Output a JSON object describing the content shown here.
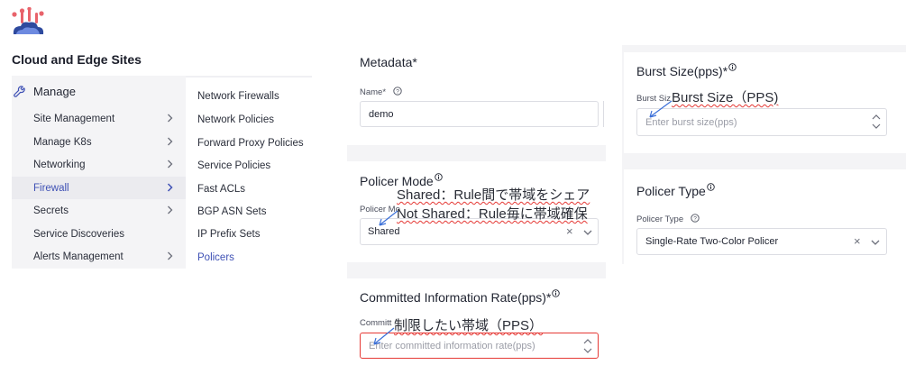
{
  "app": {
    "title": "Cloud and Edge Sites",
    "logo_icon": "cloud-logo-icon"
  },
  "nav": {
    "header": "Manage",
    "header_icon": "wrench-icon",
    "items": [
      {
        "label": "Site Management",
        "has_children": true
      },
      {
        "label": "Manage K8s",
        "has_children": true
      },
      {
        "label": "Networking",
        "has_children": true
      },
      {
        "label": "Firewall",
        "has_children": true,
        "active": true
      },
      {
        "label": "Secrets",
        "has_children": true
      },
      {
        "label": "Service Discoveries",
        "has_children": false
      },
      {
        "label": "Alerts Management",
        "has_children": true
      }
    ]
  },
  "subnav": {
    "items": [
      {
        "label": "Network Firewalls"
      },
      {
        "label": "Network Policies"
      },
      {
        "label": "Forward Proxy Policies"
      },
      {
        "label": "Service Policies"
      },
      {
        "label": "Fast ACLs"
      },
      {
        "label": "BGP ASN Sets"
      },
      {
        "label": "IP Prefix Sets"
      },
      {
        "label": "Policers",
        "active": true
      }
    ]
  },
  "metadata": {
    "title": "Metadata",
    "required_mark": "*",
    "name_label": "Name*",
    "name_value": "demo"
  },
  "policer_mode": {
    "title": "Policer Mode",
    "field_label": "Policer Mo",
    "value": "Shared"
  },
  "cir": {
    "title": "Committed Information Rate(pps)",
    "required_mark": "*",
    "field_label": "Committ",
    "placeholder": "Enter committed information rate(pps)"
  },
  "burst": {
    "title": "Burst Size(pps)",
    "required_mark": "*",
    "field_label": "Burst Siz",
    "placeholder": "Enter burst size(pps)"
  },
  "policer_type": {
    "title": "Policer Type",
    "field_label": "Policer Type",
    "value": "Single-Rate Two-Color Policer"
  },
  "annotations": {
    "burst": "Burst Size（PPS)",
    "mode_shared": "Shared：Rule間で帯域をシェア",
    "mode_not_shared": "Not Shared：Rule毎に帯域確保",
    "cir": "制限したい帯域（PPS）"
  },
  "colors": {
    "accent": "#3f51b5",
    "error": "#e53935",
    "panel_bg": "#f4f4f6"
  }
}
